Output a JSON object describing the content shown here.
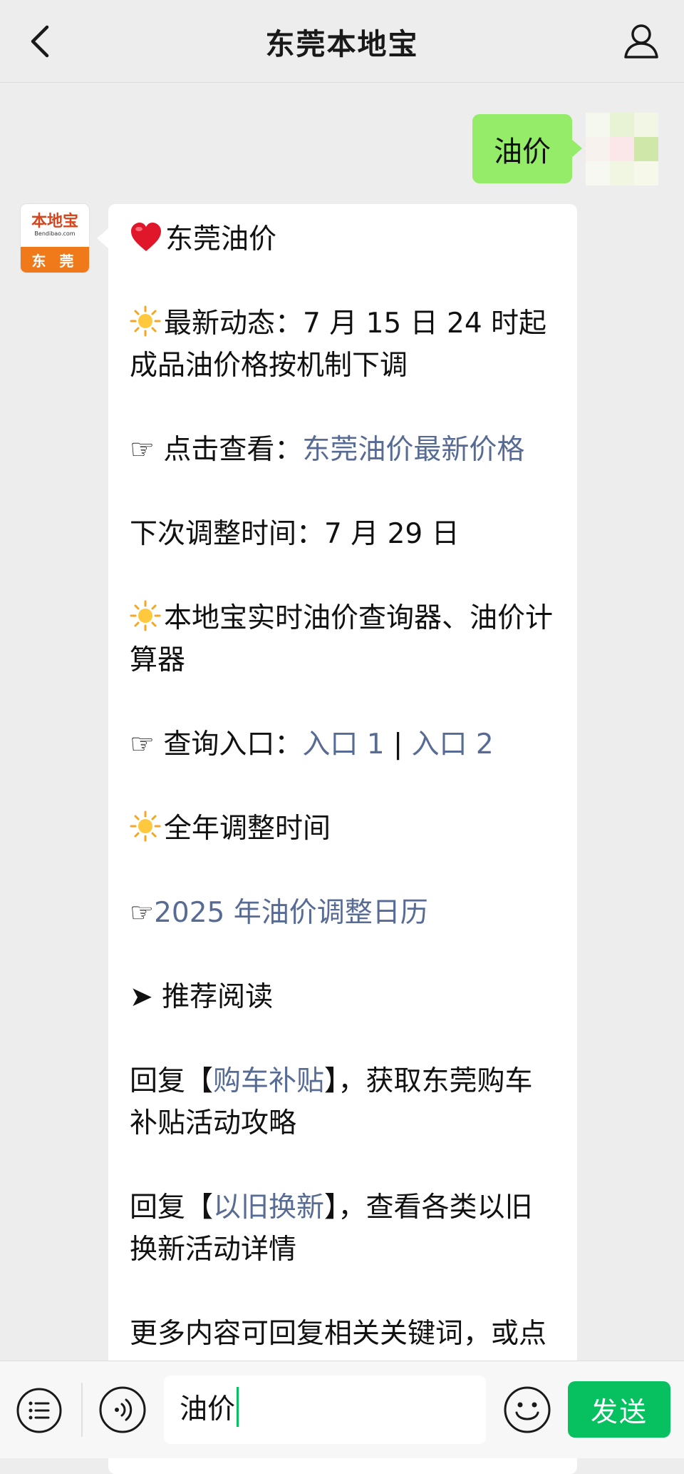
{
  "header": {
    "title": "东莞本地宝",
    "back_icon": "chevron-left-icon",
    "profile_icon": "person-icon"
  },
  "my_message": {
    "text": "油价"
  },
  "bot": {
    "avatar": {
      "logo_text": "本地宝",
      "logo_sub": "Bendibao.com",
      "city": "东 莞"
    },
    "lines": {
      "heading": "东莞油价",
      "latest_label": "最新动态：7 月 15 日 24 时起成品油价格按机制下调",
      "click_view_label": "☞ 点击查看：",
      "click_view_link": "东莞油价最新价格",
      "next_adjust": "下次调整时间：7 月 29 日",
      "tools": "本地宝实时油价查询器、油价计算器",
      "entry_label": "☞ 查询入口：",
      "entry_link_1": "入口 1",
      "entry_sep": " | ",
      "entry_link_2": "入口 2",
      "yearly": "全年调整时间",
      "calendar_hand": "☞",
      "calendar_link": "2025 年油价调整日历",
      "recommend": "➤ 推荐阅读",
      "reply1_pre": "回复【",
      "reply1_link": "购车补贴",
      "reply1_post": "】，获取东莞购车补贴活动攻略",
      "reply2_pre": "回复【",
      "reply2_link": "以旧换新",
      "reply2_post": "】，查看各类以旧换新活动详情",
      "more": "更多内容可回复相关关键词，或点"
    }
  },
  "input_bar": {
    "input_value": "油价",
    "send_label": "发送",
    "menu_icon": "list-menu-icon",
    "voice_icon": "voice-icon",
    "emoji_icon": "smiley-icon"
  },
  "colors": {
    "background": "#ededed",
    "my_bubble": "#95ec69",
    "link": "#576b95",
    "send_button": "#07c160"
  }
}
